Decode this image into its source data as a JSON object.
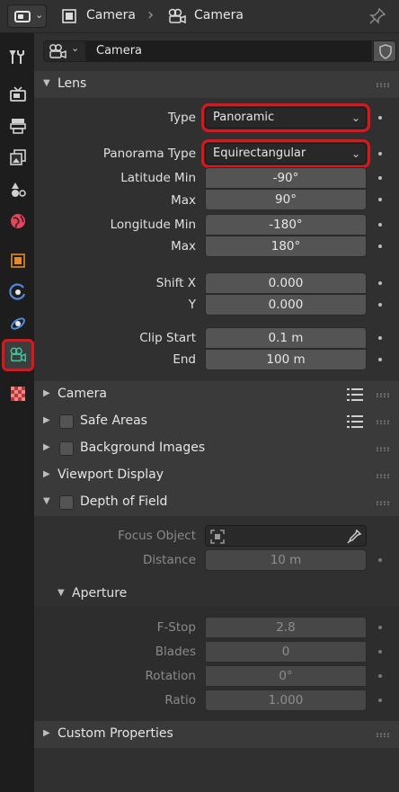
{
  "header": {
    "breadcrumb_object": "Camera",
    "breadcrumb_data": "Camera"
  },
  "tabs": [
    "tool-icon",
    "render-icon",
    "output-icon",
    "view-layer-icon",
    "scene-icon",
    "world-icon",
    "object-icon",
    "modifiers-icon",
    "physics-icon",
    "camera-data-icon",
    "texture-icon"
  ],
  "datablock": {
    "name": "Camera"
  },
  "lens": {
    "title": "Lens",
    "type_label": "Type",
    "type_value": "Panoramic",
    "pano_type_label": "Panorama Type",
    "pano_type_value": "Equirectangular",
    "lat_min_label": "Latitude Min",
    "lat_min_value": "-90°",
    "lat_max_label": "Max",
    "lat_max_value": "90°",
    "lon_min_label": "Longitude Min",
    "lon_min_value": "-180°",
    "lon_max_label": "Max",
    "lon_max_value": "180°",
    "shift_x_label": "Shift X",
    "shift_x_value": "0.000",
    "shift_y_label": "Y",
    "shift_y_value": "0.000",
    "clip_start_label": "Clip Start",
    "clip_start_value": "0.1 m",
    "clip_end_label": "End",
    "clip_end_value": "100 m"
  },
  "panels": {
    "camera": "Camera",
    "safe_areas": "Safe Areas",
    "background_images": "Background Images",
    "viewport_display": "Viewport Display",
    "depth_of_field": "Depth of Field",
    "custom_properties": "Custom Properties"
  },
  "dof": {
    "focus_object_label": "Focus Object",
    "distance_label": "Distance",
    "distance_value": "10 m",
    "aperture_title": "Aperture",
    "fstop_label": "F-Stop",
    "fstop_value": "2.8",
    "blades_label": "Blades",
    "blades_value": "0",
    "rotation_label": "Rotation",
    "rotation_value": "0°",
    "ratio_label": "Ratio",
    "ratio_value": "1.000"
  },
  "colors": {
    "highlight": "#e0141a",
    "camera_tab": "#3fc7a0"
  }
}
